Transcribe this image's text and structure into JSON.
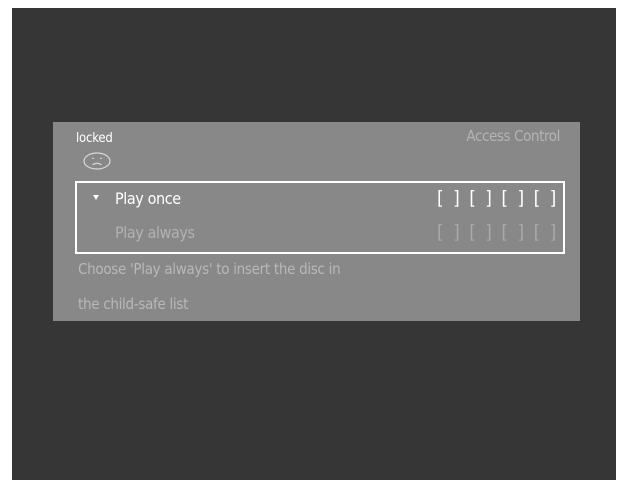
{
  "panel": {
    "status": "locked",
    "status_icon": "sad-face-icon",
    "title": "Access Control"
  },
  "options": [
    {
      "label": "Play once",
      "selected": true,
      "code": "[ ] [ ] [ ] [ ]"
    },
    {
      "label": "Play always",
      "selected": false,
      "code": "[ ] [ ] [ ] [ ]"
    }
  ],
  "help": {
    "line1": "Choose 'Play always' to insert the disc in",
    "line2": "the child-safe list"
  },
  "colors": {
    "screen_bg": "#363636",
    "panel_bg": "#888888",
    "highlight": "#ffffff",
    "dim_text": "#b2b2b2"
  }
}
